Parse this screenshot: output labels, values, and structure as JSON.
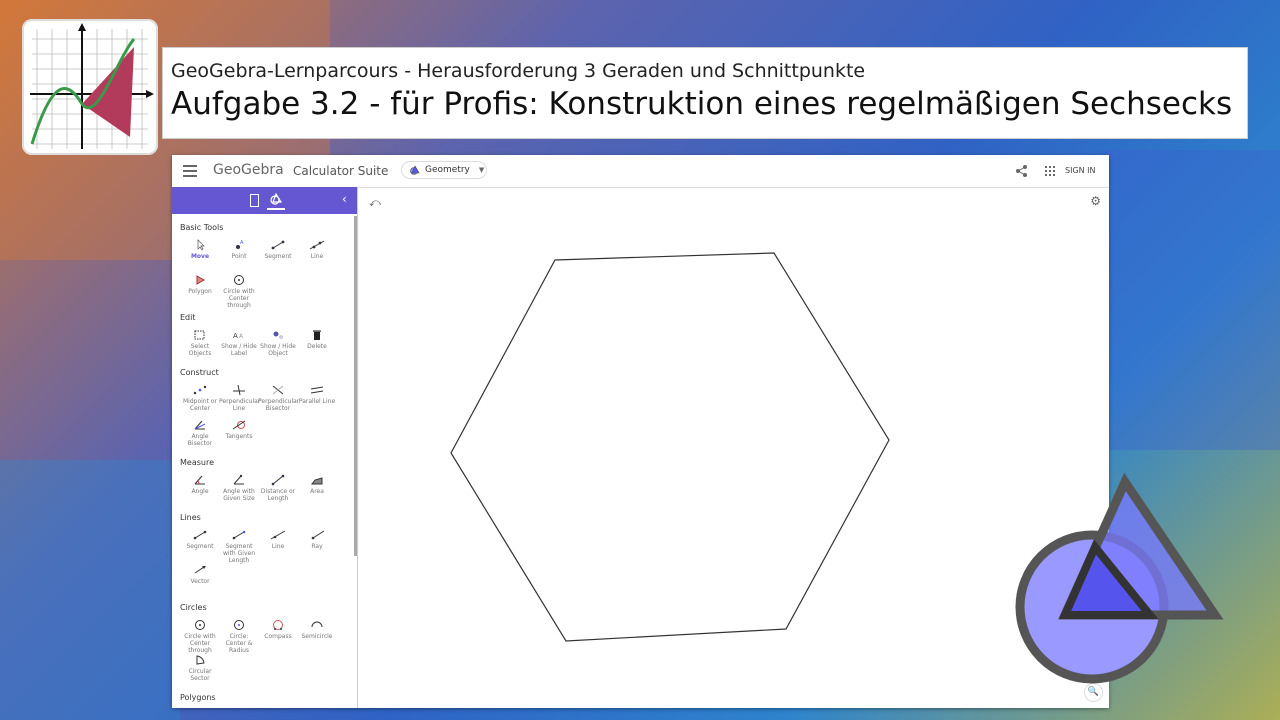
{
  "header": {
    "subtitle": "GeoGebra-Lernparcours - Herausforderung 3 Geraden und Schnittpunkte",
    "title": "Aufgabe 3.2 - für Profis: Konstruktion eines regelmäßigen Sechsecks"
  },
  "topbar": {
    "brand": "GeoGebra",
    "suite": "Calculator Suite",
    "app_picker": "Geometry",
    "sign_in": "SIGN IN"
  },
  "colors": {
    "accent": "#6557d2",
    "logo_triangle": "#b23a5a"
  },
  "tools": {
    "basic": {
      "label": "Basic Tools",
      "items": [
        "Move",
        "Point",
        "Segment",
        "Line",
        "Polygon",
        "Circle with Center through"
      ]
    },
    "edit": {
      "label": "Edit",
      "items": [
        "Select Objects",
        "Show / Hide Label",
        "Show / Hide Object",
        "Delete"
      ]
    },
    "construct": {
      "label": "Construct",
      "items": [
        "Midpoint or Center",
        "Perpendicular Line",
        "Perpendicular Bisector",
        "Parallel Line",
        "Angle Bisector",
        "Tangents"
      ]
    },
    "measure": {
      "label": "Measure",
      "items": [
        "Angle",
        "Angle with Given Size",
        "Distance or Length",
        "Area"
      ]
    },
    "lines": {
      "label": "Lines",
      "items": [
        "Segment",
        "Segment with Given Length",
        "Line",
        "Ray",
        "Vector"
      ]
    },
    "circles": {
      "label": "Circles",
      "items": [
        "Circle with Center through",
        "Circle: Center & Radius",
        "Compass",
        "Semicircle",
        "Circular Sector"
      ]
    },
    "polygons": {
      "label": "Polygons"
    }
  },
  "icons": [
    "menu-icon",
    "share-icon",
    "apps-grid-icon",
    "calculator-icon",
    "tools-icon",
    "collapse-icon",
    "undo-icon",
    "settings-icon",
    "zoom-icon"
  ]
}
